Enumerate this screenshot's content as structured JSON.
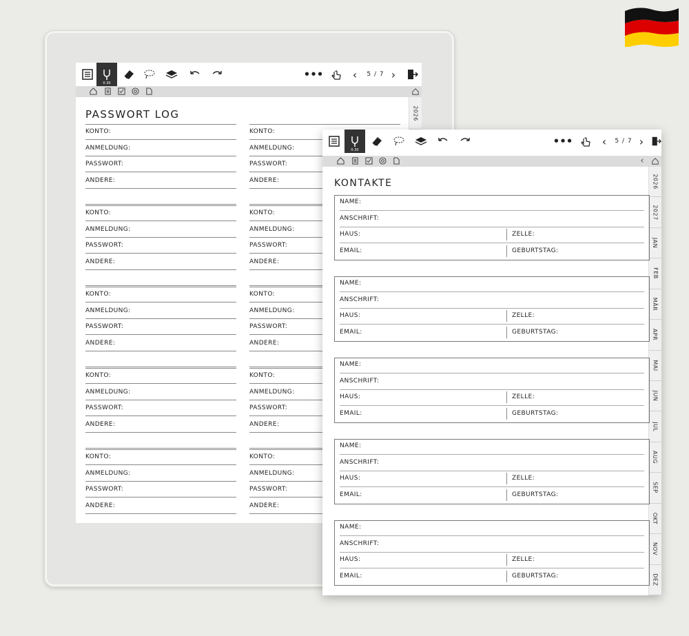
{
  "toolbar": {
    "page_indicator": "5 / 7",
    "pen_size": "0.30",
    "more": "•••",
    "prev": "‹",
    "next": "›"
  },
  "password_log": {
    "title": "PASSWORT LOG",
    "labels": {
      "account": "KONTO:",
      "login": "ANMELDUNG:",
      "password": "PASSWORT:",
      "other": "ANDERE:"
    },
    "year_tab": "2026"
  },
  "contacts": {
    "title": "KONTAKTE",
    "labels": {
      "name": "NAME:",
      "address": "ANSCHRIFT:",
      "home": "HAUS:",
      "cell": "ZELLE:",
      "email": "EMAIL:",
      "birthday": "GEBURTSTAG:"
    },
    "back_arrow": "‹"
  },
  "side_tabs": [
    "2026",
    "2027",
    "JAN",
    "FEB",
    "MÄR",
    "APR",
    "MAI",
    "JUN",
    "JUL",
    "AUG",
    "SEP",
    "OKT",
    "NOV",
    "DEZ"
  ],
  "icons": {
    "flag": "germany-flag"
  }
}
